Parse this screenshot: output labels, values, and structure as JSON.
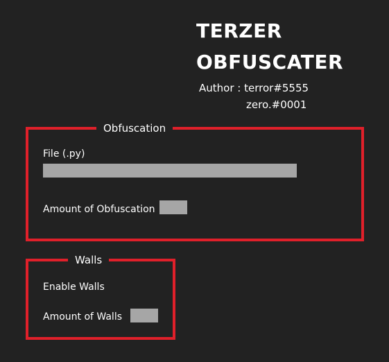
{
  "header": {
    "title_line1": "TERZER",
    "title_line2": "OBFUSCATER",
    "author_line1": "Author : terror#5555",
    "author_line2": "zero.#0001"
  },
  "obfuscation": {
    "group_label": "Obfuscation",
    "file_label": "File (.py)",
    "file_value": "",
    "amount_label": "Amount of Obfuscation",
    "amount_value": ""
  },
  "walls": {
    "group_label": "Walls",
    "enable_label": "Enable Walls",
    "amount_label": "Amount of Walls",
    "amount_value": ""
  },
  "colors": {
    "background": "#222222",
    "accent_border": "#e0202a",
    "field_fill": "#a6a6a6",
    "text": "#ffffff"
  }
}
